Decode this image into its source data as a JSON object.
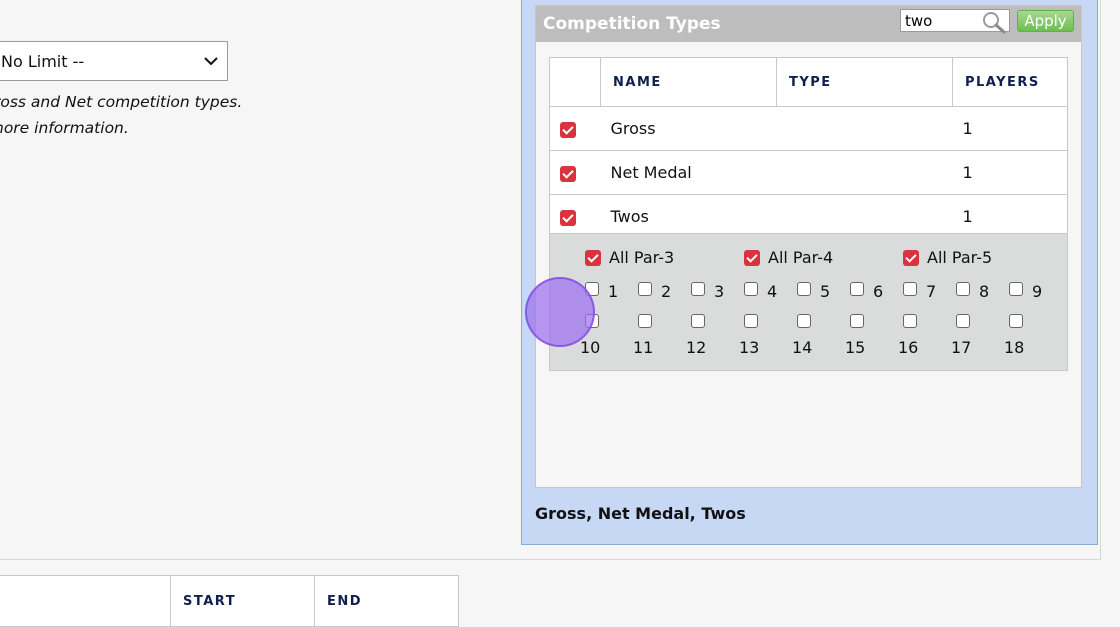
{
  "left": {
    "limit_select_value": "No Limit --",
    "note_line1": "ross and Net competition types.",
    "note_line2": "nore information."
  },
  "panel": {
    "title": "Competition Types",
    "search_value": "two",
    "apply_label": "Apply",
    "columns": [
      "NAME",
      "TYPE",
      "PLAYERS"
    ],
    "rows": [
      {
        "name": "Gross",
        "type": "",
        "players": "1",
        "checked": true
      },
      {
        "name": "Net Medal",
        "type": "",
        "players": "1",
        "checked": true
      },
      {
        "name": "Twos",
        "type": "",
        "players": "1",
        "checked": true
      }
    ],
    "par_options": [
      {
        "label": "All Par-3",
        "checked": true
      },
      {
        "label": "All Par-4",
        "checked": true
      },
      {
        "label": "All Par-5",
        "checked": true
      }
    ],
    "holes": [
      "1",
      "2",
      "3",
      "4",
      "5",
      "6",
      "7",
      "8",
      "9",
      "10",
      "11",
      "12",
      "13",
      "14",
      "15",
      "16",
      "17",
      "18"
    ],
    "summary": "Gross, Net Medal, Twos"
  },
  "lower_table": {
    "columns": [
      "",
      "START",
      "END"
    ]
  },
  "colors": {
    "checkbox_red": "#d9333f",
    "panel_blue": "#c7d8f4",
    "apply_green": "#6cbf4f",
    "header_text": "#0f1f4f"
  }
}
